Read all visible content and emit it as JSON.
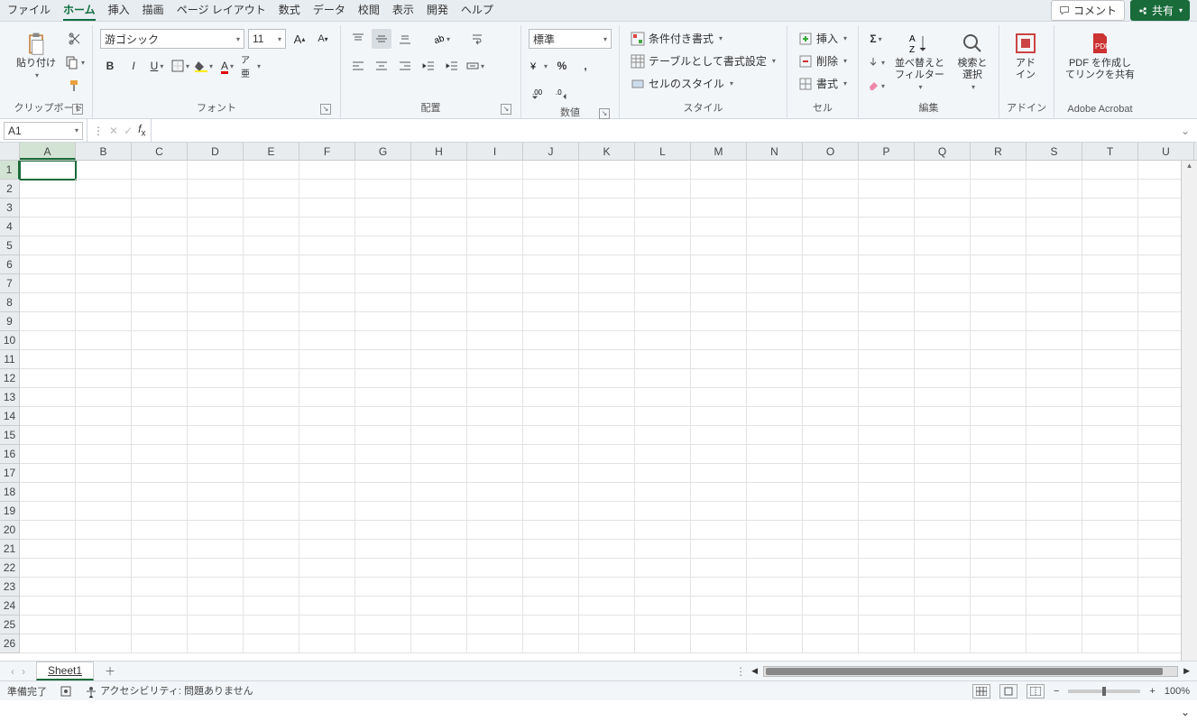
{
  "tabs": {
    "file": "ファイル",
    "home": "ホーム",
    "insert": "挿入",
    "draw": "描画",
    "layout": "ページ レイアウト",
    "formulas": "数式",
    "data": "データ",
    "review": "校閲",
    "view": "表示",
    "dev": "開発",
    "help": "ヘルプ"
  },
  "topRight": {
    "comment": "コメント",
    "share": "共有"
  },
  "ribbon": {
    "clipboard": {
      "label": "クリップボード",
      "paste": "貼り付け"
    },
    "font": {
      "label": "フォント",
      "name": "游ゴシック",
      "size": "11"
    },
    "align": {
      "label": "配置"
    },
    "number": {
      "label": "数値",
      "format": "標準"
    },
    "styles": {
      "label": "スタイル",
      "cond": "条件付き書式",
      "table": "テーブルとして書式設定",
      "cell": "セルのスタイル"
    },
    "cells": {
      "label": "セル",
      "insert": "挿入",
      "delete": "削除",
      "format": "書式"
    },
    "editing": {
      "label": "編集",
      "sort": "並べ替えと\nフィルター",
      "find": "検索と\n選択"
    },
    "addin": {
      "label": "アドイン",
      "btn": "アド\nイン"
    },
    "acrobat": {
      "label": "Adobe Acrobat",
      "btn": "PDF を作成し\nてリンクを共有"
    }
  },
  "nameBox": "A1",
  "columns": [
    "A",
    "B",
    "C",
    "D",
    "E",
    "F",
    "G",
    "H",
    "I",
    "J",
    "K",
    "L",
    "M",
    "N",
    "O",
    "P",
    "Q",
    "R",
    "S",
    "T",
    "U"
  ],
  "rowCount": 26,
  "activeCell": {
    "row": 1,
    "col": 0
  },
  "sheet": {
    "name": "Sheet1"
  },
  "status": {
    "ready": "準備完了",
    "access": "アクセシビリティ: 問題ありません",
    "zoom": "100%"
  }
}
